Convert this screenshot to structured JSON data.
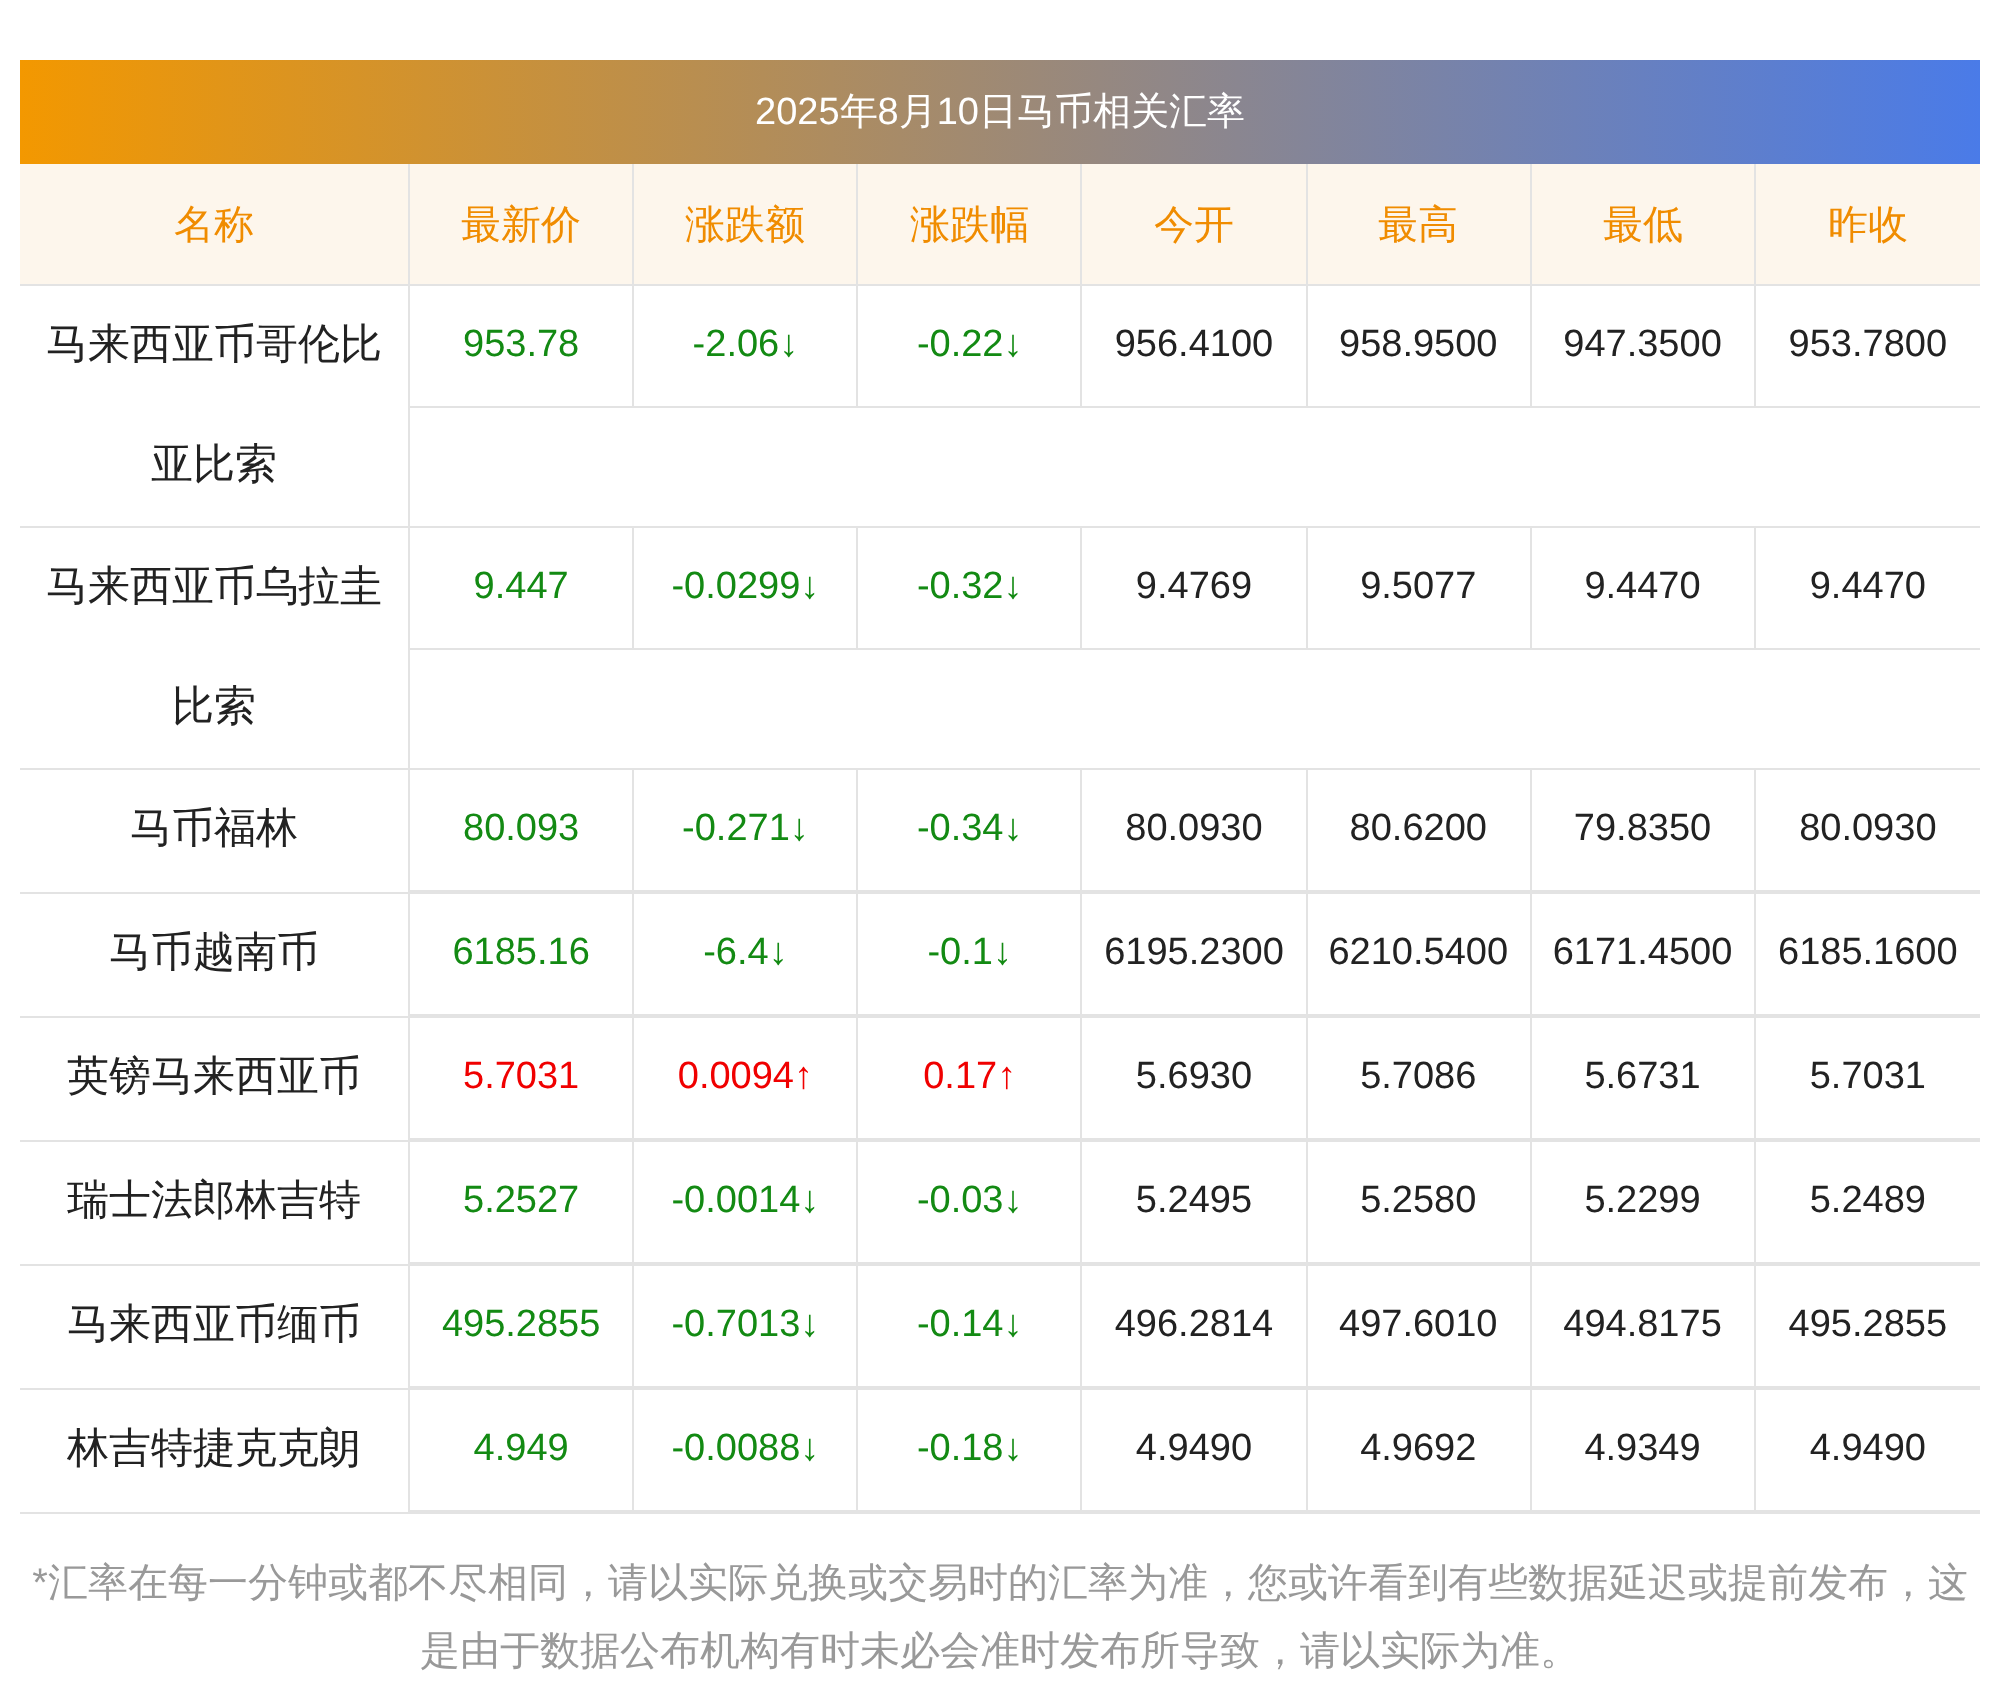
{
  "title": "2025年8月10日马币相关汇率",
  "columns": [
    "名称",
    "最新价",
    "涨跌额",
    "涨跌幅",
    "今开",
    "最高",
    "最低",
    "昨收"
  ],
  "rows": [
    {
      "name": "马来西亚币哥伦比亚比索",
      "kind": "down",
      "latest": "953.78",
      "change": "-2.06↓",
      "change_pct": "-0.22↓",
      "open": "956.4100",
      "high": "958.9500",
      "low": "947.3500",
      "prev_close": "953.7800"
    },
    {
      "name": "马来西亚币乌拉圭比索",
      "kind": "down",
      "latest": "9.447",
      "change": "-0.0299↓",
      "change_pct": "-0.32↓",
      "open": "9.4769",
      "high": "9.5077",
      "low": "9.4470",
      "prev_close": "9.4470"
    },
    {
      "name": "马币福林",
      "kind": "down",
      "latest": "80.093",
      "change": "-0.271↓",
      "change_pct": "-0.34↓",
      "open": "80.0930",
      "high": "80.6200",
      "low": "79.8350",
      "prev_close": "80.0930"
    },
    {
      "name": "马币越南币",
      "kind": "down",
      "latest": "6185.16",
      "change": "-6.4↓",
      "change_pct": "-0.1↓",
      "open": "6195.2300",
      "high": "6210.5400",
      "low": "6171.4500",
      "prev_close": "6185.1600"
    },
    {
      "name": "英镑马来西亚币",
      "kind": "up",
      "latest": "5.7031",
      "change": "0.0094↑",
      "change_pct": "0.17↑",
      "open": "5.6930",
      "high": "5.7086",
      "low": "5.6731",
      "prev_close": "5.7031"
    },
    {
      "name": "瑞士法郎林吉特",
      "kind": "down",
      "latest": "5.2527",
      "change": "-0.0014↓",
      "change_pct": "-0.03↓",
      "open": "5.2495",
      "high": "5.2580",
      "low": "5.2299",
      "prev_close": "5.2489"
    },
    {
      "name": "马来西亚币缅币",
      "kind": "down",
      "latest": "495.2855",
      "change": "-0.7013↓",
      "change_pct": "-0.14↓",
      "open": "496.2814",
      "high": "497.6010",
      "low": "494.8175",
      "prev_close": "495.2855"
    },
    {
      "name": "林吉特捷克克朗",
      "kind": "down",
      "latest": "4.949",
      "change": "-0.0088↓",
      "change_pct": "-0.18↓",
      "open": "4.9490",
      "high": "4.9692",
      "low": "4.9349",
      "prev_close": "4.9490"
    }
  ],
  "footnote": "*汇率在每一分钟或都不尽相同，请以实际兑换或交易时的汇率为准，您或许看到有些数据延迟或提前发布，这是由于数据公布机构有时未必会准时发布所导致，请以实际为准。"
}
